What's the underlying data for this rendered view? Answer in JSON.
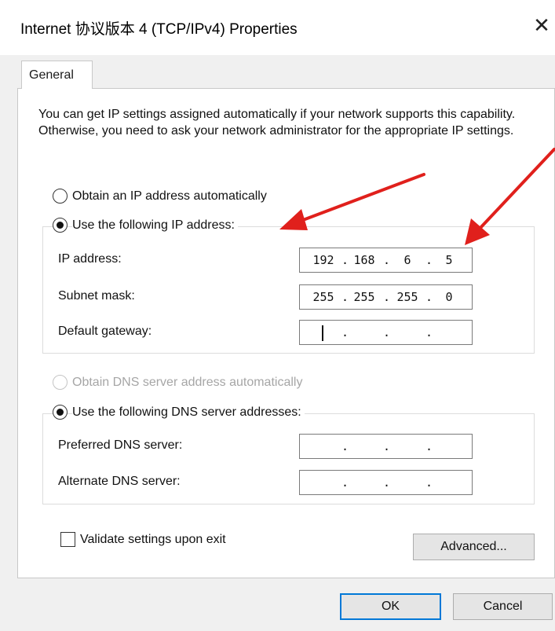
{
  "window": {
    "title": "Internet 协议版本 4 (TCP/IPv4) Properties",
    "close_glyph": "✕"
  },
  "tabs": [
    {
      "label": "General",
      "selected": true
    }
  ],
  "intro_text": "You can get IP settings assigned automatically if your network supports this capability. Otherwise, you need to ask your network administrator for the appropriate IP settings.",
  "ip_settings": {
    "auto_option": {
      "label": "Obtain an IP address automatically",
      "checked": false,
      "enabled": true
    },
    "manual_option": {
      "label": "Use the following IP address:",
      "checked": true,
      "enabled": true
    },
    "fields": {
      "ip_address": {
        "label": "IP address:",
        "octets": [
          "192",
          "168",
          "6",
          "5"
        ]
      },
      "subnet_mask": {
        "label": "Subnet mask:",
        "octets": [
          "255",
          "255",
          "255",
          "0"
        ]
      },
      "default_gateway": {
        "label": "Default gateway:",
        "octets": [
          "",
          "",
          "",
          ""
        ]
      }
    }
  },
  "dns_settings": {
    "auto_option": {
      "label": "Obtain DNS server address automatically",
      "checked": false,
      "enabled": false
    },
    "manual_option": {
      "label": "Use the following DNS server addresses:",
      "checked": true,
      "enabled": true
    },
    "fields": {
      "preferred": {
        "label": "Preferred DNS server:",
        "octets": [
          "",
          "",
          "",
          ""
        ]
      },
      "alternate": {
        "label": "Alternate DNS server:",
        "octets": [
          "",
          "",
          "",
          ""
        ]
      }
    }
  },
  "validate_checkbox": {
    "label": "Validate settings upon exit",
    "checked": false
  },
  "buttons": {
    "advanced": "Advanced...",
    "ok": "OK",
    "cancel": "Cancel"
  },
  "colors": {
    "annotation_arrow": "#e0201c",
    "focus_border": "#0078d7"
  }
}
